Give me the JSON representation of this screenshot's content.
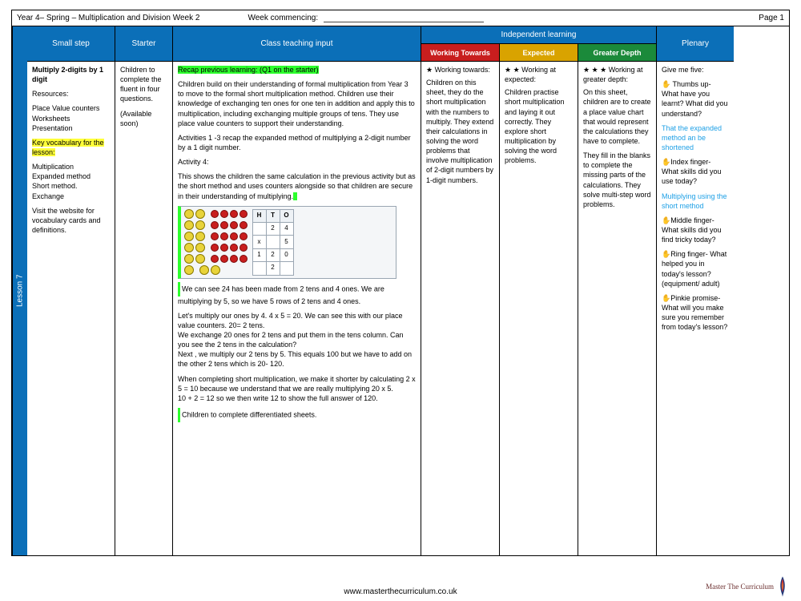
{
  "meta": {
    "title": "Year 4– Spring – Multiplication and Division Week 2",
    "week_label": "Week commencing:",
    "page_label": "Page 1",
    "lesson_tab": "Lesson 7",
    "footer_url": "www.masterthecurriculum.co.uk",
    "brand": "Master The Curriculum"
  },
  "headers": {
    "small_step": "Small step",
    "starter": "Starter",
    "input": "Class teaching input",
    "independent": "Independent learning",
    "plenary": "Plenary",
    "working_towards": "Working Towards",
    "expected": "Expected",
    "greater_depth": "Greater Depth"
  },
  "small_step": {
    "title": "Multiply 2-digits by 1 digit",
    "resources_label": "Resources:",
    "resources": "Place Value counters Worksheets Presentation",
    "keyvocab_hl": "Key vocabulary for the lesson:",
    "vocab": "Multiplication\nExpanded method\nShort method.\nExchange",
    "visit": "Visit the website for vocabulary cards and definitions."
  },
  "starter": {
    "text": "Children to complete the fluent in four questions.",
    "avail": "(Available soon)"
  },
  "input": {
    "recap_hl": "Recap previous learning: (Q1 on the starter)",
    "p1": "Children build on their understanding of formal multiplication from Year 3 to move to the formal short multiplication method. Children use their knowledge of exchanging ten ones for one ten in addition and apply this to multiplication, including exchanging multiple groups of tens. They use place value counters to support their understanding.",
    "p2": "Activities 1 -3 recap the expanded method of multiplying a 2-digit number by a 1 digit number.",
    "act4_label": "Activity 4:",
    "act4": "This shows the children the same calculation in the previous activity but as the short method and uses counters alongside so that children are secure in their understanding of multiplying.",
    "p3": "We can see 24 has been made from 2 tens and 4 ones. We are multiplying by 5, so we have 5 rows of 2 tens and 4 ones.",
    "p4a": "Let's multiply our ones by 4. 4 x 5 = 20. We can see this with our place value counters. 20= 2 tens.",
    "p4b": "We exchange 20 ones for 2 tens and put them in the tens column. Can you see the 2 tens in the calculation?",
    "p4c": "Next , we multiply our 2 tens by 5. This equals 100 but we have to add on the other 2 tens which is 20- 120.",
    "p5a": "When completing short multiplication, we make it shorter by calculating 2 x 5 = 10 because we understand that we are really multiplying 20 x 5.",
    "p5b": "10 + 2 = 12 so we then write 12 to show the full answer of 120.",
    "p6": "Children to complete differentiated sheets."
  },
  "wt": {
    "stars": "★  Working towards:",
    "body": "Children on this sheet, they do the short multiplication with the numbers to multiply. They extend their calculations in solving the word problems that involve multiplication of 2-digit numbers by 1-digit numbers."
  },
  "ex": {
    "stars": "★ ★  Working at expected:",
    "body": "Children practise short multiplication and laying it out correctly. They explore short multiplication by solving the word problems."
  },
  "gd": {
    "stars": "★ ★ ★  Working at greater depth:",
    "body1": "On this sheet, children are to create a place value chart that would represent the calculations they have to complete.",
    "body2": "They fill in the blanks to complete the missing parts of the calculations. They solve multi-step word problems."
  },
  "plenary": {
    "give": "Give me five:",
    "thumbs": "✋ Thumbs up- What have you learnt? What did you understand?",
    "thumbs_ans": "That the expanded method an be shortened",
    "index": "✋Index finger- What skills did you use today?",
    "index_ans": "Multiplying using the short method",
    "middle": "✋Middle finger- What skills did you find tricky today?",
    "ring": "✋Ring finger- What helped you in today's lesson? (equipment/ adult)",
    "pinkie": "✋Pinkie promise- What will you make sure you remember from today's lesson?"
  },
  "calc": {
    "h": "H",
    "t": "T",
    "o": "O",
    "top_t": "2",
    "top_o": "4",
    "mult": "x",
    "mult_o": "5",
    "ans_h": "1",
    "ans_t": "2",
    "ans_o": "0",
    "carry_t": "2"
  }
}
